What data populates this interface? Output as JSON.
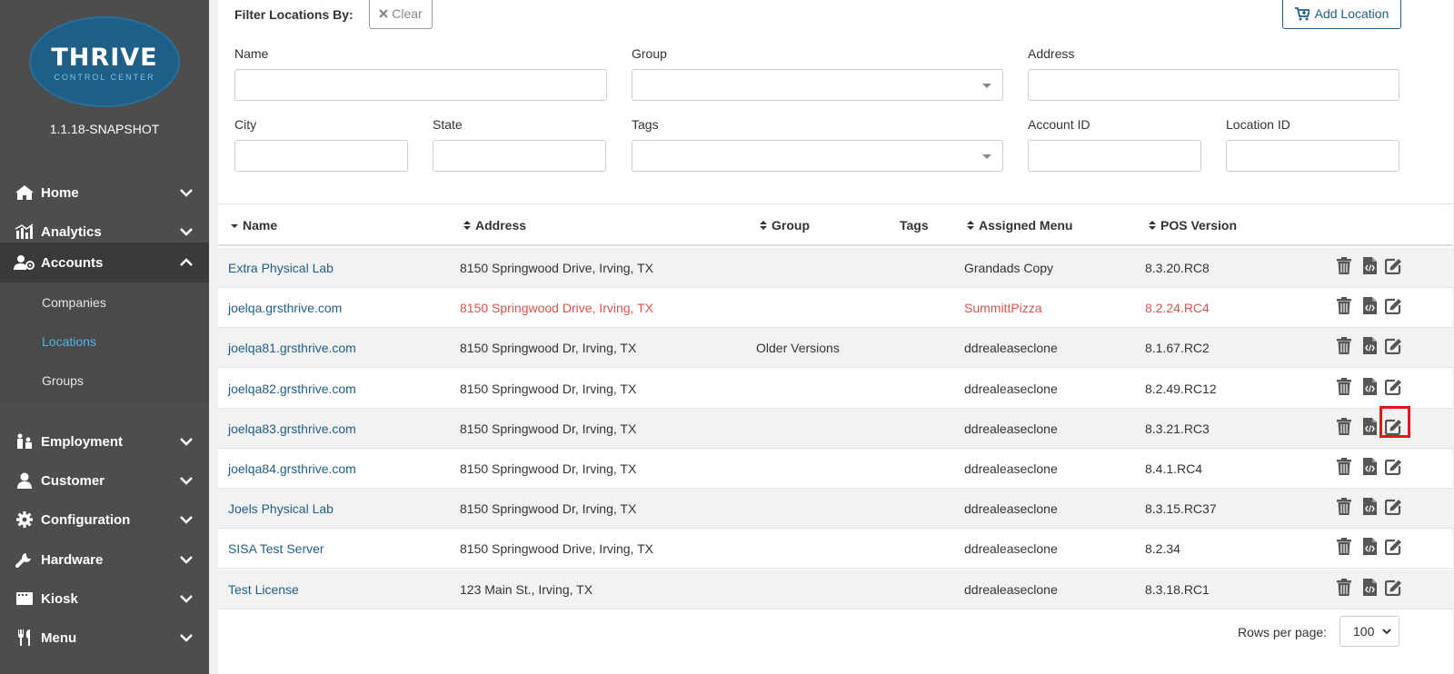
{
  "app": {
    "brand": "THRIVE",
    "brand_sub": "CONTROL CENTER",
    "version": "1.1.18-SNAPSHOT",
    "colors": {
      "sidebar": "#4d4d4d",
      "accent": "#1f5e86",
      "link": "#1f5e86",
      "active_sub": "#4db6ea",
      "alert": "#d9534f",
      "highlight": "#e3141a"
    }
  },
  "sidebar": {
    "items": [
      {
        "label": "Home",
        "icon": "home-icon",
        "expanded": false
      },
      {
        "label": "Analytics",
        "icon": "chart-icon",
        "expanded": false
      },
      {
        "label": "Accounts",
        "icon": "users-icon",
        "expanded": true
      },
      {
        "label": "Employment",
        "icon": "employees-icon",
        "expanded": false
      },
      {
        "label": "Customer",
        "icon": "user-icon",
        "expanded": false
      },
      {
        "label": "Configuration",
        "icon": "gear-icon",
        "expanded": false
      },
      {
        "label": "Hardware",
        "icon": "wrench-icon",
        "expanded": false
      },
      {
        "label": "Kiosk",
        "icon": "kiosk-icon",
        "expanded": false
      },
      {
        "label": "Menu",
        "icon": "utensils-icon",
        "expanded": false
      }
    ],
    "accounts_sub": [
      "Companies",
      "Locations",
      "Groups"
    ],
    "active_sub": "Locations"
  },
  "filters": {
    "title": "Filter Locations By:",
    "clear_label": "Clear",
    "add_label": "Add Location",
    "fields": {
      "name": {
        "label": "Name",
        "value": ""
      },
      "group": {
        "label": "Group",
        "value": ""
      },
      "address": {
        "label": "Address",
        "value": ""
      },
      "city": {
        "label": "City",
        "value": ""
      },
      "state": {
        "label": "State",
        "value": ""
      },
      "tags": {
        "label": "Tags",
        "value": ""
      },
      "account_id": {
        "label": "Account ID",
        "value": ""
      },
      "location_id": {
        "label": "Location ID",
        "value": ""
      }
    }
  },
  "table": {
    "headers": {
      "name": "Name",
      "address": "Address",
      "group": "Group",
      "tags": "Tags",
      "menu": "Assigned Menu",
      "pos": "POS Version"
    },
    "rows": [
      {
        "name": "Extra Physical Lab",
        "address": "8150 Springwood Drive, Irving, TX",
        "group": "",
        "tags": "",
        "menu": "Grandads Copy",
        "pos": "8.3.20.RC8",
        "alert": false
      },
      {
        "name": "joelqa.grsthrive.com",
        "address": "8150 Springwood Drive, Irving, TX",
        "group": "",
        "tags": "",
        "menu": "SummittPizza",
        "pos": "8.2.24.RC4",
        "alert": true
      },
      {
        "name": "joelqa81.grsthrive.com",
        "address": "8150 Springwood Dr, Irving, TX",
        "group": "Older Versions",
        "tags": "",
        "menu": "ddrealeaseclone",
        "pos": "8.1.67.RC2",
        "alert": false
      },
      {
        "name": "joelqa82.grsthrive.com",
        "address": "8150 Springwood Dr, Irving, TX",
        "group": "",
        "tags": "",
        "menu": "ddrealeaseclone",
        "pos": "8.2.49.RC12",
        "alert": false
      },
      {
        "name": "joelqa83.grsthrive.com",
        "address": "8150 Springwood Dr, Irving, TX",
        "group": "",
        "tags": "",
        "menu": "ddrealeaseclone",
        "pos": "8.3.21.RC3",
        "alert": false
      },
      {
        "name": "joelqa84.grsthrive.com",
        "address": "8150 Springwood Dr, Irving, TX",
        "group": "",
        "tags": "",
        "menu": "ddrealeaseclone",
        "pos": "8.4.1.RC4",
        "alert": false
      },
      {
        "name": "Joels Physical Lab",
        "address": "8150 Springwood Dr, Irving, TX",
        "group": "",
        "tags": "",
        "menu": "ddrealeaseclone",
        "pos": "8.3.15.RC37",
        "alert": false
      },
      {
        "name": "SISA Test Server",
        "address": "8150 Springwood Drive, Irving, TX",
        "group": "",
        "tags": "",
        "menu": "ddrealeaseclone",
        "pos": "8.2.34",
        "alert": false
      },
      {
        "name": "Test License",
        "address": "123 Main St., Irving, TX",
        "group": "",
        "tags": "",
        "menu": "ddrealeaseclone",
        "pos": "8.3.18.RC1",
        "alert": false
      }
    ],
    "row_actions": [
      "trash-icon",
      "code-file-icon",
      "edit-icon"
    ],
    "highlighted_action": {
      "row": 5,
      "action": "edit-icon"
    }
  },
  "pagination": {
    "rows_per_page_label": "Rows per page:",
    "rows_per_page": "100"
  }
}
